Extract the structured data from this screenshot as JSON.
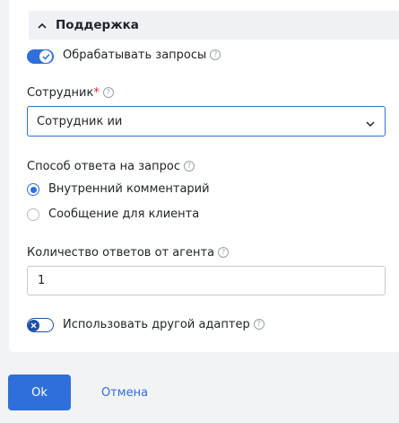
{
  "section": {
    "title": "Поддержка"
  },
  "process_toggle": {
    "label": "Обрабатывать запросы",
    "state": "on"
  },
  "employee": {
    "label": "Сотрудник",
    "required_mark": "*",
    "selected": "Сотрудник ии"
  },
  "reply_method": {
    "label": "Способ ответа на запрос",
    "options": [
      {
        "label": "Внутренний комментарий",
        "selected": true
      },
      {
        "label": "Сообщение для клиента",
        "selected": false
      }
    ]
  },
  "agent_replies": {
    "label": "Количество ответов от агента",
    "value": "1"
  },
  "other_adapter_toggle": {
    "label": "Использовать другой адаптер",
    "state": "off"
  },
  "help_glyph": "?",
  "footer": {
    "ok_label": "Ok",
    "cancel_label": "Отмена"
  },
  "colors": {
    "accent": "#2f6fd9",
    "required": "#d6263b",
    "background": "#f2f3f5"
  }
}
